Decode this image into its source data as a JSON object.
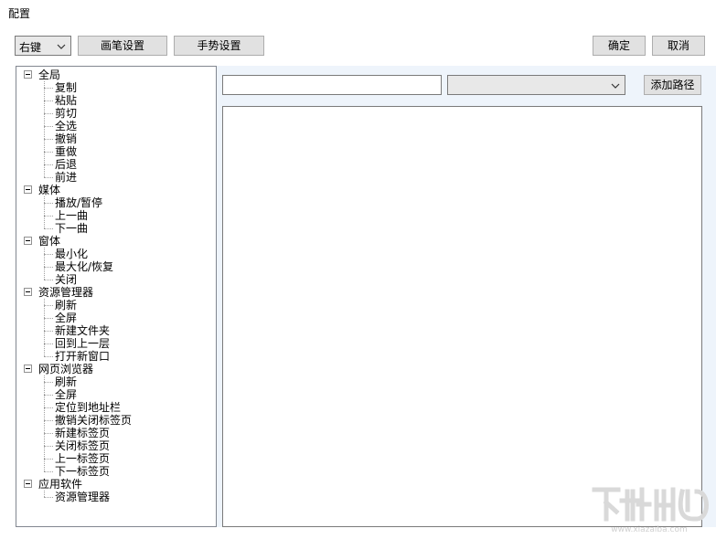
{
  "window": {
    "title": "配置"
  },
  "toolbar": {
    "mouse_button": "右键",
    "pen_settings": "画笔设置",
    "gesture_settings": "手势设置",
    "ok": "确定",
    "cancel": "取消"
  },
  "editor": {
    "path_value": "",
    "action_select_value": "",
    "add_path": "添加路径"
  },
  "tree": [
    {
      "label": "全局",
      "children": [
        "复制",
        "粘贴",
        "剪切",
        "全选",
        "撤销",
        "重做",
        "后退",
        "前进"
      ]
    },
    {
      "label": "媒体",
      "children": [
        "播放/暂停",
        "上一曲",
        "下一曲"
      ]
    },
    {
      "label": "窗体",
      "children": [
        "最小化",
        "最大化/恢复",
        "关闭"
      ]
    },
    {
      "label": "资源管理器",
      "children": [
        "刷新",
        "全屏",
        "新建文件夹",
        "回到上一层",
        "打开新窗口"
      ]
    },
    {
      "label": "网页浏览器",
      "children": [
        "刷新",
        "全屏",
        "定位到地址栏",
        "撤销关闭标签页",
        "新建标签页",
        "关闭标签页",
        "上一标签页",
        "下一标签页"
      ]
    },
    {
      "label": "应用软件",
      "children": [
        "资源管理器"
      ]
    }
  ],
  "colors": {
    "panel_bg": "#eef4fb",
    "button_bg": "#e1e1e1",
    "border": "#7a7a7a"
  }
}
